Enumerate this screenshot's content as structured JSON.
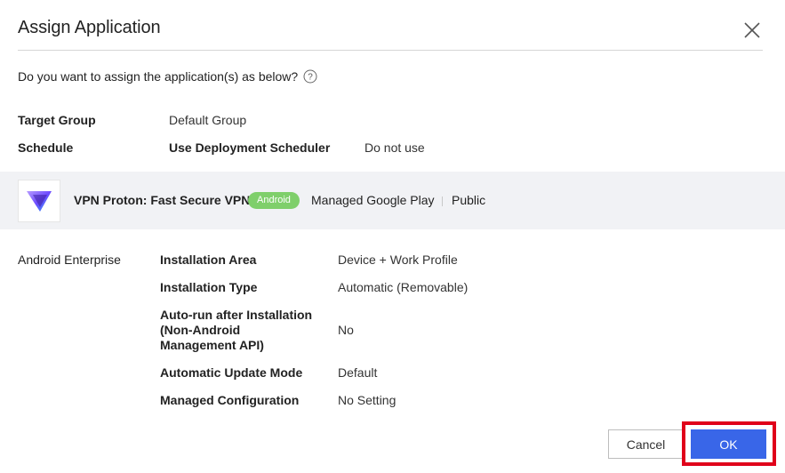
{
  "dialog": {
    "title": "Assign Application",
    "question": "Do you want to assign the application(s) as below?"
  },
  "summary": {
    "target_group_label": "Target Group",
    "target_group_value": "Default Group",
    "schedule_label": "Schedule",
    "scheduler_label": "Use Deployment Scheduler",
    "scheduler_value": "Do not use"
  },
  "app": {
    "name": "VPN Proton: Fast Secure VPN",
    "platform_badge": "Android",
    "store": "Managed Google Play",
    "visibility": "Public"
  },
  "settings": {
    "section_label": "Android Enterprise",
    "rows": [
      {
        "label": "Installation Area",
        "value": "Device + Work Profile"
      },
      {
        "label": "Installation Type",
        "value": "Automatic (Removable)"
      },
      {
        "label_lines": [
          "Auto-run after Installation",
          "(Non-Android",
          "Management API)"
        ],
        "value": "No"
      },
      {
        "label": "Automatic Update Mode",
        "value": "Default"
      },
      {
        "label": "Managed Configuration",
        "value": "No Setting"
      }
    ]
  },
  "buttons": {
    "cancel": "Cancel",
    "ok": "OK"
  },
  "colors": {
    "primary": "#3966e8",
    "badge": "#7fcf6b",
    "highlight": "#e0001a",
    "band": "#f1f2f5"
  }
}
